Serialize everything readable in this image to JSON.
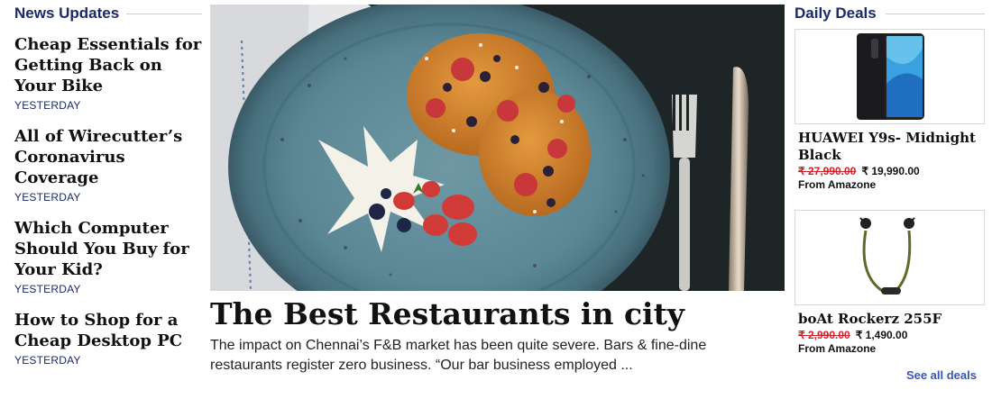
{
  "news": {
    "heading": "News Updates",
    "items": [
      {
        "title": "Cheap Essentials for Getting Back on Your Bike",
        "time": "YESTERDAY"
      },
      {
        "title": "All of Wirecutter’s Coronavirus Coverage",
        "time": "YESTERDAY"
      },
      {
        "title": "Which Computer Should You Buy for Your Kid?",
        "time": "YESTERDAY"
      },
      {
        "title": "How to Shop for a Cheap Desktop PC",
        "time": "YESTERDAY"
      }
    ]
  },
  "featured": {
    "title": "The Best Restaurants in city",
    "excerpt": "The impact on Chennai’s F&B market has been quite severe. Bars & fine-dine restaurants register zero business. “Our bar business employed ..."
  },
  "deals": {
    "heading": "Daily Deals",
    "items": [
      {
        "name": "HUAWEI Y9s- Midnight Black",
        "old_price": "₹ 27,990.00",
        "new_price": "₹ 19,990.00",
        "source": "From Amazone"
      },
      {
        "name": "boAt Rockerz 255F",
        "old_price": "₹ 2,990.00",
        "new_price": "₹ 1,490.00",
        "source": "From Amazone"
      }
    ],
    "see_all": "See all deals"
  },
  "colors": {
    "accent": "#1a2a6c",
    "link": "#3b55b5",
    "strike": "#d0202a"
  }
}
